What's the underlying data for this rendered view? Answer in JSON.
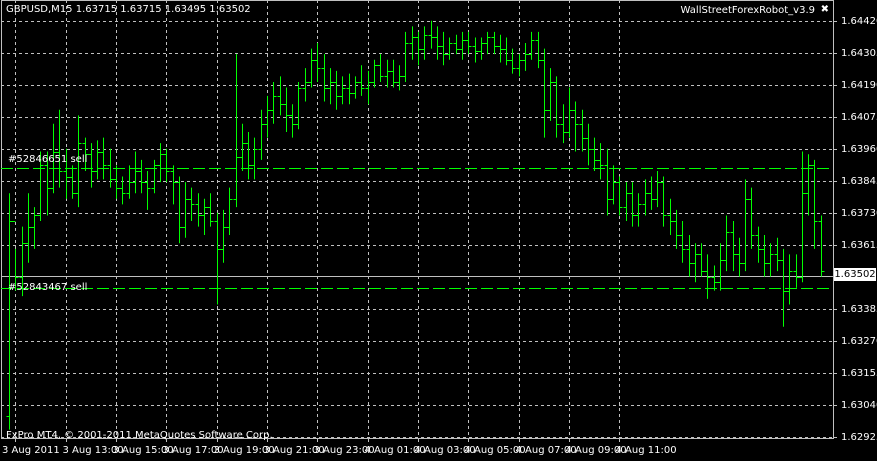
{
  "window": {
    "symbol_header": "GBPUSD,M15  1.63715 1.63715 1.63495 1.63502",
    "ea_name": "WallStreetForexRobot_v3.9",
    "ea_close_icon": "✖",
    "copyright": "FxPro MT4, © 2001-2011 MetaQuotes Software Corp."
  },
  "colors": {
    "background": "#000000",
    "bars": "#00ff00",
    "grid": "#c0c0c0",
    "text": "#ffffff"
  },
  "chart_data": {
    "type": "ohlc-bar",
    "symbol": "GBPUSD",
    "timeframe": "M15",
    "ylim": [
      1.6292,
      1.6443
    ],
    "grid": true,
    "y_ticks": [
      "1.64420",
      "1.64305",
      "1.64190",
      "1.64075",
      "1.63960",
      "1.63845",
      "1.63730",
      "1.63615",
      "1.63502",
      "1.63385",
      "1.63270",
      "1.63155",
      "1.63040",
      "1.62925"
    ],
    "x_ticks": [
      "3 Aug 2011",
      "3 Aug 13:00",
      "3 Aug 15:00",
      "3 Aug 17:00",
      "3 Aug 19:00",
      "3 Aug 21:00",
      "3 Aug 23:00",
      "4 Aug 01:00",
      "4 Aug 03:00",
      "4 Aug 05:00",
      "4 Aug 07:00",
      "4 Aug 09:00",
      "4 Aug 11:00"
    ],
    "last_price": "1.63502",
    "orders": [
      {
        "label": "#52846651 sell",
        "price": 1.6389
      },
      {
        "label": "#52843467 sell",
        "price": 1.6346
      }
    ],
    "ohlc": [
      [
        1.63,
        1.638,
        1.6295,
        1.637
      ],
      [
        1.637,
        1.636,
        1.6345,
        1.635
      ],
      [
        1.635,
        1.6368,
        1.6343,
        1.6362
      ],
      [
        1.6362,
        1.638,
        1.6355,
        1.6368
      ],
      [
        1.6368,
        1.6375,
        1.636,
        1.6372
      ],
      [
        1.6372,
        1.6395,
        1.637,
        1.639
      ],
      [
        1.639,
        1.6395,
        1.6372,
        1.6382
      ],
      [
        1.6382,
        1.6405,
        1.638,
        1.6395
      ],
      [
        1.6395,
        1.641,
        1.6382,
        1.6388
      ],
      [
        1.6388,
        1.6396,
        1.6378,
        1.6386
      ],
      [
        1.6386,
        1.639,
        1.6378,
        1.638
      ],
      [
        1.638,
        1.6408,
        1.6375,
        1.6398
      ],
      [
        1.6398,
        1.64,
        1.6388,
        1.6394
      ],
      [
        1.6394,
        1.6398,
        1.6382,
        1.6388
      ],
      [
        1.6388,
        1.6399,
        1.6385,
        1.6395
      ],
      [
        1.6395,
        1.64,
        1.6385,
        1.639
      ],
      [
        1.639,
        1.6396,
        1.6382,
        1.6385
      ],
      [
        1.6385,
        1.639,
        1.6378,
        1.6382
      ],
      [
        1.6382,
        1.6386,
        1.6376,
        1.638
      ],
      [
        1.638,
        1.639,
        1.6378,
        1.6384
      ],
      [
        1.6384,
        1.6395,
        1.638,
        1.6388
      ],
      [
        1.6388,
        1.6392,
        1.638,
        1.6384
      ],
      [
        1.6384,
        1.6388,
        1.6374,
        1.6382
      ],
      [
        1.6382,
        1.6392,
        1.638,
        1.639
      ],
      [
        1.639,
        1.6398,
        1.6384,
        1.6394
      ],
      [
        1.6394,
        1.6396,
        1.6384,
        1.6388
      ],
      [
        1.6388,
        1.639,
        1.6376,
        1.6384
      ],
      [
        1.6384,
        1.6386,
        1.6362,
        1.6368
      ],
      [
        1.6368,
        1.6384,
        1.6364,
        1.6378
      ],
      [
        1.6378,
        1.6382,
        1.637,
        1.6376
      ],
      [
        1.6376,
        1.638,
        1.6368,
        1.6372
      ],
      [
        1.6372,
        1.6378,
        1.6365,
        1.6375
      ],
      [
        1.6375,
        1.638,
        1.6368,
        1.637
      ],
      [
        1.637,
        1.6373,
        1.634,
        1.636
      ],
      [
        1.636,
        1.6374,
        1.6355,
        1.6368
      ],
      [
        1.6368,
        1.6382,
        1.6365,
        1.6378
      ],
      [
        1.6378,
        1.643,
        1.6375,
        1.6393
      ],
      [
        1.6393,
        1.6405,
        1.6388,
        1.6398
      ],
      [
        1.6398,
        1.6402,
        1.6385,
        1.639
      ],
      [
        1.639,
        1.64,
        1.6385,
        1.6396
      ],
      [
        1.6396,
        1.641,
        1.6392,
        1.6405
      ],
      [
        1.6405,
        1.6415,
        1.64,
        1.641
      ],
      [
        1.641,
        1.642,
        1.6405,
        1.6415
      ],
      [
        1.6415,
        1.6422,
        1.6408,
        1.6412
      ],
      [
        1.6412,
        1.6418,
        1.6402,
        1.6408
      ],
      [
        1.6408,
        1.6412,
        1.64,
        1.6405
      ],
      [
        1.6405,
        1.642,
        1.6403,
        1.6418
      ],
      [
        1.6418,
        1.6425,
        1.6413,
        1.642
      ],
      [
        1.642,
        1.6432,
        1.6418,
        1.6428
      ],
      [
        1.6428,
        1.6434,
        1.642,
        1.6425
      ],
      [
        1.6425,
        1.643,
        1.6413,
        1.6418
      ],
      [
        1.6418,
        1.6425,
        1.6412,
        1.642
      ],
      [
        1.642,
        1.6424,
        1.641,
        1.6415
      ],
      [
        1.6415,
        1.6422,
        1.6412,
        1.6418
      ],
      [
        1.6418,
        1.6423,
        1.6412,
        1.6416
      ],
      [
        1.6416,
        1.6422,
        1.6414,
        1.642
      ],
      [
        1.642,
        1.6426,
        1.6415,
        1.6418
      ],
      [
        1.6418,
        1.6424,
        1.6412,
        1.642
      ],
      [
        1.642,
        1.6428,
        1.6418,
        1.6426
      ],
      [
        1.6426,
        1.643,
        1.642,
        1.6422
      ],
      [
        1.6422,
        1.6428,
        1.6418,
        1.6424
      ],
      [
        1.6424,
        1.6428,
        1.6418,
        1.642
      ],
      [
        1.642,
        1.6426,
        1.6417,
        1.6422
      ],
      [
        1.6422,
        1.6438,
        1.642,
        1.6434
      ],
      [
        1.6434,
        1.644,
        1.6428,
        1.6436
      ],
      [
        1.6436,
        1.6438,
        1.6426,
        1.6432
      ],
      [
        1.6432,
        1.644,
        1.6428,
        1.6437
      ],
      [
        1.6437,
        1.6442,
        1.6432,
        1.6436
      ],
      [
        1.6436,
        1.644,
        1.6428,
        1.6433
      ],
      [
        1.6433,
        1.6438,
        1.6426,
        1.643
      ],
      [
        1.643,
        1.6436,
        1.6428,
        1.6434
      ],
      [
        1.6434,
        1.6437,
        1.643,
        1.6432
      ],
      [
        1.6432,
        1.6438,
        1.6428,
        1.6435
      ],
      [
        1.6435,
        1.6438,
        1.643,
        1.6433
      ],
      [
        1.6433,
        1.6436,
        1.6427,
        1.6431
      ],
      [
        1.6431,
        1.6436,
        1.6428,
        1.6434
      ],
      [
        1.6434,
        1.6438,
        1.643,
        1.6436
      ],
      [
        1.6436,
        1.6438,
        1.643,
        1.6433
      ],
      [
        1.6433,
        1.6437,
        1.6427,
        1.6432
      ],
      [
        1.6432,
        1.6436,
        1.6426,
        1.6428
      ],
      [
        1.6428,
        1.6432,
        1.6423,
        1.6425
      ],
      [
        1.6425,
        1.643,
        1.6422,
        1.6428
      ],
      [
        1.6428,
        1.6434,
        1.6424,
        1.643
      ],
      [
        1.643,
        1.6438,
        1.6428,
        1.6435
      ],
      [
        1.6435,
        1.6438,
        1.6425,
        1.6428
      ],
      [
        1.6428,
        1.6432,
        1.64,
        1.641
      ],
      [
        1.641,
        1.6425,
        1.6406,
        1.642
      ],
      [
        1.642,
        1.6422,
        1.64,
        1.6405
      ],
      [
        1.6405,
        1.6412,
        1.6398,
        1.6402
      ],
      [
        1.6402,
        1.6418,
        1.64,
        1.641
      ],
      [
        1.641,
        1.6413,
        1.6395,
        1.6405
      ],
      [
        1.6405,
        1.641,
        1.6395,
        1.64
      ],
      [
        1.64,
        1.6405,
        1.639,
        1.6396
      ],
      [
        1.6396,
        1.64,
        1.6388,
        1.6392
      ],
      [
        1.6392,
        1.6398,
        1.6385,
        1.639
      ],
      [
        1.639,
        1.6396,
        1.6372,
        1.6378
      ],
      [
        1.6378,
        1.639,
        1.6376,
        1.6384
      ],
      [
        1.6384,
        1.6386,
        1.6372,
        1.6375
      ],
      [
        1.6375,
        1.6384,
        1.637,
        1.638
      ],
      [
        1.638,
        1.6384,
        1.6368,
        1.6372
      ],
      [
        1.6372,
        1.638,
        1.6368,
        1.6376
      ],
      [
        1.6376,
        1.6385,
        1.6372,
        1.638
      ],
      [
        1.638,
        1.6386,
        1.6374,
        1.6378
      ],
      [
        1.6378,
        1.6388,
        1.6375,
        1.6384
      ],
      [
        1.6384,
        1.6386,
        1.6368,
        1.6372
      ],
      [
        1.6372,
        1.6378,
        1.6365,
        1.637
      ],
      [
        1.637,
        1.6374,
        1.636,
        1.6365
      ],
      [
        1.6365,
        1.637,
        1.6355,
        1.636
      ],
      [
        1.636,
        1.6365,
        1.635,
        1.6355
      ],
      [
        1.6355,
        1.6362,
        1.6348,
        1.6358
      ],
      [
        1.6358,
        1.6362,
        1.635,
        1.6352
      ],
      [
        1.6352,
        1.6358,
        1.6342,
        1.635
      ],
      [
        1.635,
        1.6354,
        1.6345,
        1.6348
      ],
      [
        1.6348,
        1.6362,
        1.6345,
        1.6356
      ],
      [
        1.6356,
        1.6372,
        1.6352,
        1.6366
      ],
      [
        1.6366,
        1.637,
        1.6352,
        1.6358
      ],
      [
        1.6358,
        1.6364,
        1.635,
        1.6355
      ],
      [
        1.6355,
        1.6385,
        1.6352,
        1.6378
      ],
      [
        1.6378,
        1.6382,
        1.636,
        1.6365
      ],
      [
        1.6365,
        1.6368,
        1.6355,
        1.636
      ],
      [
        1.636,
        1.6365,
        1.635,
        1.6355
      ],
      [
        1.6355,
        1.6362,
        1.635,
        1.6358
      ],
      [
        1.6358,
        1.6364,
        1.6352,
        1.6356
      ],
      [
        1.6356,
        1.636,
        1.6332,
        1.6345
      ],
      [
        1.6345,
        1.6358,
        1.634,
        1.6352
      ],
      [
        1.6352,
        1.6358,
        1.6346,
        1.635
      ],
      [
        1.635,
        1.6395,
        1.6348,
        1.638
      ],
      [
        1.638,
        1.6394,
        1.6372,
        1.639
      ],
      [
        1.639,
        1.6392,
        1.636,
        1.637
      ],
      [
        1.637,
        1.6372,
        1.635,
        1.6352
      ]
    ]
  }
}
